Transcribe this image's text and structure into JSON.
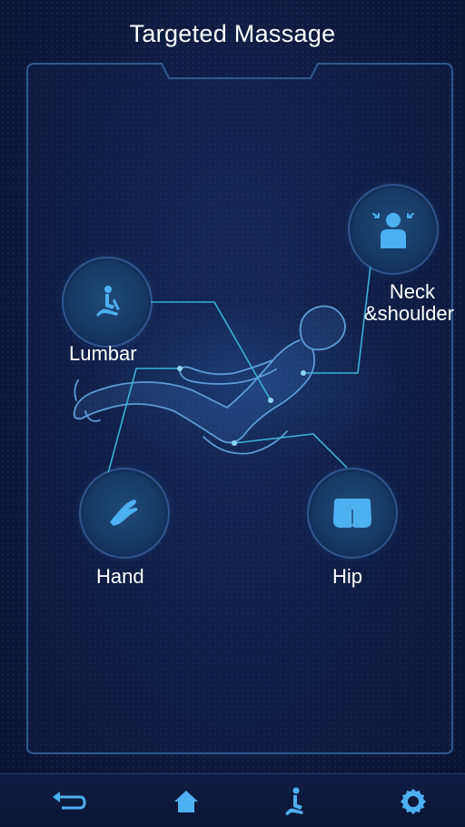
{
  "header": {
    "title": "Targeted Massage"
  },
  "zones": {
    "lumbar": {
      "label": "Lumbar",
      "icon": "recline-chair-icon"
    },
    "neck": {
      "label_line1": "Neck",
      "label_line2": "&shoulder",
      "icon": "neck-shoulder-icon"
    },
    "hand": {
      "label": "Hand",
      "icon": "hand-icon"
    },
    "hip": {
      "label": "Hip",
      "icon": "hip-icon"
    }
  },
  "bottom_nav": {
    "items": [
      {
        "icon": "back-arrow-icon"
      },
      {
        "icon": "home-icon"
      },
      {
        "icon": "seated-person-icon"
      },
      {
        "icon": "settings-gear-icon"
      }
    ]
  },
  "colors": {
    "accent": "#3aa0e8",
    "icon_blue": "#4db0f0",
    "frame_line": "#2d5a8e",
    "connector": "#3ab0d8",
    "background": "#0d1a3d"
  }
}
